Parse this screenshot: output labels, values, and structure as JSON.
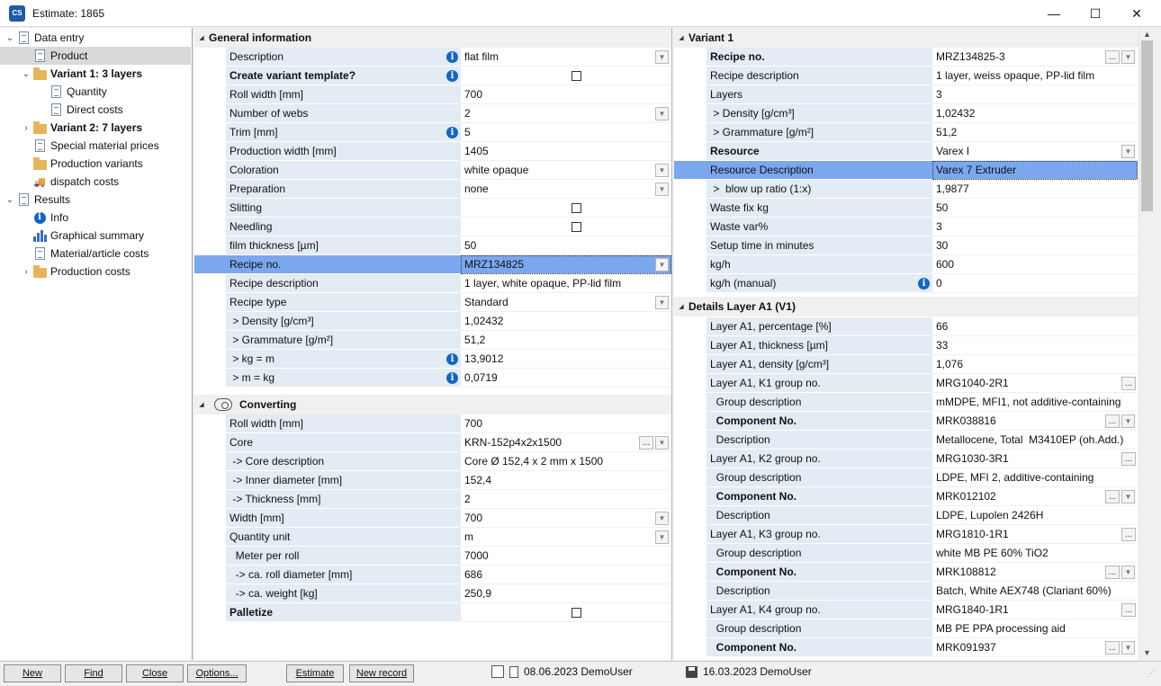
{
  "window": {
    "title": "Estimate: 1865",
    "icon_text": "CS",
    "controls": [
      "—",
      "☐",
      "✕"
    ]
  },
  "nav": {
    "items": [
      {
        "label": "Data entry",
        "arrow": "⌄",
        "icon": "doc-icon",
        "bold": false
      },
      {
        "label": "Product",
        "arrow": "",
        "icon": "product-icon",
        "bold": false,
        "selected": true
      },
      {
        "label": "Variant 1: 3 layers",
        "arrow": "⌄",
        "icon": "folder-icon",
        "bold": true
      },
      {
        "label": "Quantity",
        "arrow": "",
        "icon": "chart-doc-icon",
        "bold": false
      },
      {
        "label": "Direct costs",
        "arrow": "",
        "icon": "doc-icon",
        "bold": false
      },
      {
        "label": "Variant 2: 7 layers",
        "arrow": "›",
        "icon": "folder-icon",
        "bold": true
      },
      {
        "label": "Special material prices",
        "arrow": "",
        "icon": "doc-icon",
        "bold": false
      },
      {
        "label": "Production variants",
        "arrow": "",
        "icon": "folder-icon",
        "bold": false
      },
      {
        "label": "dispatch costs",
        "arrow": "",
        "icon": "truck-icon",
        "bold": false
      },
      {
        "label": "Results",
        "arrow": "⌄",
        "icon": "doc-icon",
        "bold": false
      },
      {
        "label": "Info",
        "arrow": "",
        "icon": "info-icon",
        "bold": false
      },
      {
        "label": "Graphical summary",
        "arrow": "",
        "icon": "bar-chart-icon",
        "bold": false
      },
      {
        "label": "Material/article costs",
        "arrow": "",
        "icon": "doc-icon",
        "bold": false
      },
      {
        "label": "Production costs",
        "arrow": "›",
        "icon": "folder-icon",
        "bold": false
      }
    ]
  },
  "left": {
    "sections": [
      {
        "title": "General information",
        "icon": ""
      },
      {
        "title": "Converting",
        "icon": "roll-core-icon"
      }
    ],
    "general": [
      {
        "label": "Description",
        "value": "flat film",
        "info": true,
        "dropdown": true
      },
      {
        "label": "Create variant template?",
        "value": "",
        "info": true,
        "bold": true,
        "checkbox": true
      },
      {
        "label": "Roll width [mm]",
        "value": "700"
      },
      {
        "label": "Number of webs",
        "value": "2",
        "dropdown": true
      },
      {
        "label": "Trim [mm]",
        "value": "5",
        "info": true
      },
      {
        "label": "Production width [mm]",
        "value": "1405"
      },
      {
        "label": "Coloration",
        "value": "white opaque",
        "dropdown": true
      },
      {
        "label": "Preparation",
        "value": "none",
        "dropdown": true
      },
      {
        "label": "Slitting",
        "value": "",
        "checkbox": true
      },
      {
        "label": "Needling",
        "value": "",
        "checkbox": true
      },
      {
        "label": "film thickness [µm]",
        "value": "50"
      },
      {
        "label": "Recipe no.",
        "value": "MRZ134825",
        "dropdown": true,
        "highlight": true
      },
      {
        "label": "Recipe description",
        "value": "1 layer, white opaque, PP-lid film"
      },
      {
        "label": "Recipe type",
        "value": "Standard",
        "dropdown": true
      },
      {
        "label": " > Density [g/cm³]",
        "value": "1,02432"
      },
      {
        "label": " > Grammature [g/m²]",
        "value": "51,2"
      },
      {
        "label": " > kg = m",
        "value": "13,9012",
        "info": true
      },
      {
        "label": " > m = kg",
        "value": "0,0719",
        "info": true
      }
    ],
    "converting": [
      {
        "label": "Roll width [mm]",
        "value": "700"
      },
      {
        "label": "Core",
        "value": "KRN-152p4x2x1500",
        "dots": true,
        "dropdown": true
      },
      {
        "label": " -> Core description",
        "value": "Core Ø 152,4 x 2 mm x 1500"
      },
      {
        "label": " -> Inner diameter [mm]",
        "value": "152,4"
      },
      {
        "label": " -> Thickness [mm]",
        "value": "2"
      },
      {
        "label": "Width [mm]",
        "value": "700",
        "dropdown": true
      },
      {
        "label": "Quantity unit",
        "value": "m",
        "dropdown": true
      },
      {
        "label": "  Meter per roll",
        "value": "7000"
      },
      {
        "label": "  -> ca. roll diameter [mm]",
        "value": "686"
      },
      {
        "label": "  -> ca. weight [kg]",
        "value": "250,9"
      },
      {
        "label": "Palletize",
        "value": "",
        "bold": true,
        "checkbox": true
      }
    ]
  },
  "right": {
    "sections": [
      {
        "title": "Variant 1"
      },
      {
        "title": "Details Layer A1 (V1)"
      }
    ],
    "variant": [
      {
        "label": "Recipe no.",
        "value": "MRZ134825-3",
        "bold": true,
        "dots": true,
        "dropdown": true
      },
      {
        "label": "Recipe description",
        "value": "1 layer, weiss opaque, PP-lid film"
      },
      {
        "label": "Layers",
        "value": "3"
      },
      {
        "label": " > Density [g/cm³]",
        "value": "1,02432"
      },
      {
        "label": " > Grammature [g/m²]",
        "value": "51,2"
      },
      {
        "label": "Resource",
        "value": "Varex I",
        "bold": true,
        "dropdown": true
      },
      {
        "label": "Resource Description",
        "value": "Varex 7 Extruder",
        "highlight": true
      },
      {
        "label": " >  blow up ratio (1:x)",
        "value": "1,9877"
      },
      {
        "label": "Waste fix kg",
        "value": "50"
      },
      {
        "label": "Waste var%",
        "value": "3"
      },
      {
        "label": "Setup time in minutes",
        "value": "30"
      },
      {
        "label": "kg/h",
        "value": "600"
      },
      {
        "label": "kg/h (manual)",
        "value": "0",
        "info": true
      }
    ],
    "details": [
      {
        "label": "Layer A1, percentage [%]",
        "value": "66"
      },
      {
        "label": "Layer A1, thickness [µm]",
        "value": "33"
      },
      {
        "label": "Layer A1, density [g/cm³]",
        "value": "1,076"
      },
      {
        "label": "Layer A1, K1 group no.",
        "value": "MRG1040-2R1",
        "dots": true
      },
      {
        "label": "  Group description",
        "value": "mMDPE, MFI1, not additive-containing"
      },
      {
        "label": "  Component No.",
        "value": "MRK038816",
        "bold": true,
        "dots": true,
        "dropdown": true
      },
      {
        "label": "  Description",
        "value": "Metallocene, Total  M3410EP (oh.Add.)"
      },
      {
        "label": "Layer A1, K2 group no.",
        "value": "MRG1030-3R1",
        "dots": true
      },
      {
        "label": "  Group description",
        "value": "LDPE, MFI 2, additive-containing"
      },
      {
        "label": "  Component No.",
        "value": "MRK012102",
        "bold": true,
        "dots": true,
        "dropdown": true
      },
      {
        "label": "  Description",
        "value": "LDPE, Lupolen 2426H"
      },
      {
        "label": "Layer A1, K3 group no.",
        "value": "MRG1810-1R1",
        "dots": true
      },
      {
        "label": "  Group description",
        "value": "white MB PE 60% TiO2"
      },
      {
        "label": "  Component No.",
        "value": "MRK108812",
        "bold": true,
        "dots": true,
        "dropdown": true
      },
      {
        "label": "  Description",
        "value": "Batch, White AEX748 (Clariant 60%)"
      },
      {
        "label": "Layer A1, K4 group no.",
        "value": "MRG1840-1R1",
        "dots": true
      },
      {
        "label": "  Group description",
        "value": "MB PE PPA processing aid"
      },
      {
        "label": "  Component No.",
        "value": "MRK091937",
        "bold": true,
        "dots": true,
        "dropdown": true
      }
    ]
  },
  "statusbar": {
    "buttons": [
      "New",
      "Find",
      "Close",
      "Options...",
      "Estimate",
      "New record"
    ],
    "created": "08.06.2023 DemoUser",
    "saved": "16.03.2023 DemoUser"
  }
}
